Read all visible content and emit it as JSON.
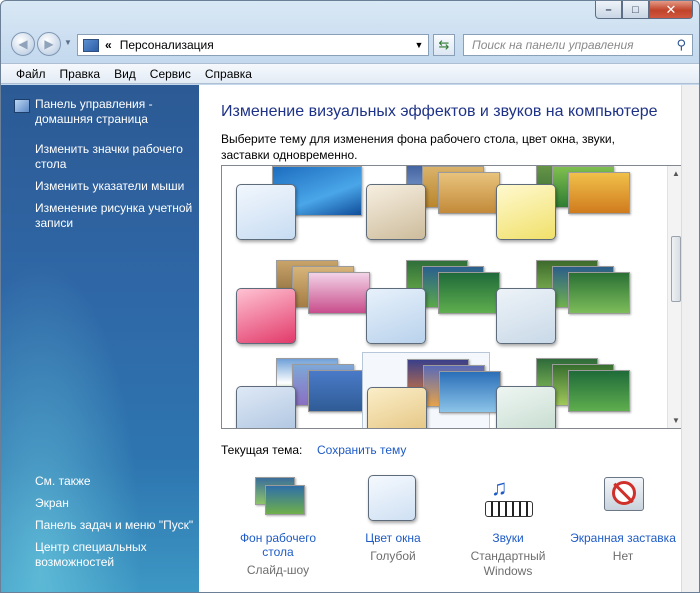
{
  "window": {
    "minimize": "–",
    "maximize": "□",
    "close": "✕"
  },
  "address": {
    "chevrons": "«",
    "path": "Персонализация",
    "search_placeholder": "Поиск на панели управления"
  },
  "menu": [
    "Файл",
    "Правка",
    "Вид",
    "Сервис",
    "Справка"
  ],
  "sidebar": {
    "home": "Панель управления - домашняя страница",
    "links": [
      "Изменить значки рабочего стола",
      "Изменить указатели мыши",
      "Изменение рисунка учетной записи"
    ],
    "see_also_title": "См. также",
    "see_also": [
      "Экран",
      "Панель задач и меню \"Пуск\"",
      "Центр специальных возможностей"
    ]
  },
  "main": {
    "title": "Изменение визуальных эффектов и звуков на компьютере",
    "description": "Выберите тему для изменения фона рабочего стола, цвет окна, звуки, заставки одновременно.",
    "current_theme_label": "Текущая тема:",
    "save_theme": "Сохранить тему",
    "settings": [
      {
        "icon": "desktop-background-icon",
        "label": "Фон рабочего стола",
        "value": "Слайд-шоу"
      },
      {
        "icon": "window-color-icon",
        "label": "Цвет окна",
        "value": "Голубой"
      },
      {
        "icon": "sounds-icon",
        "label": "Звуки",
        "value": "Стандартный Windows"
      },
      {
        "icon": "screensaver-icon",
        "label": "Экранная заставка",
        "value": "Нет"
      }
    ]
  },
  "colors": {
    "link": "#1e5bc6",
    "title": "#1e3287",
    "sidebar_top": "#2c5a94",
    "sidebar_bottom": "#3d98c4"
  }
}
